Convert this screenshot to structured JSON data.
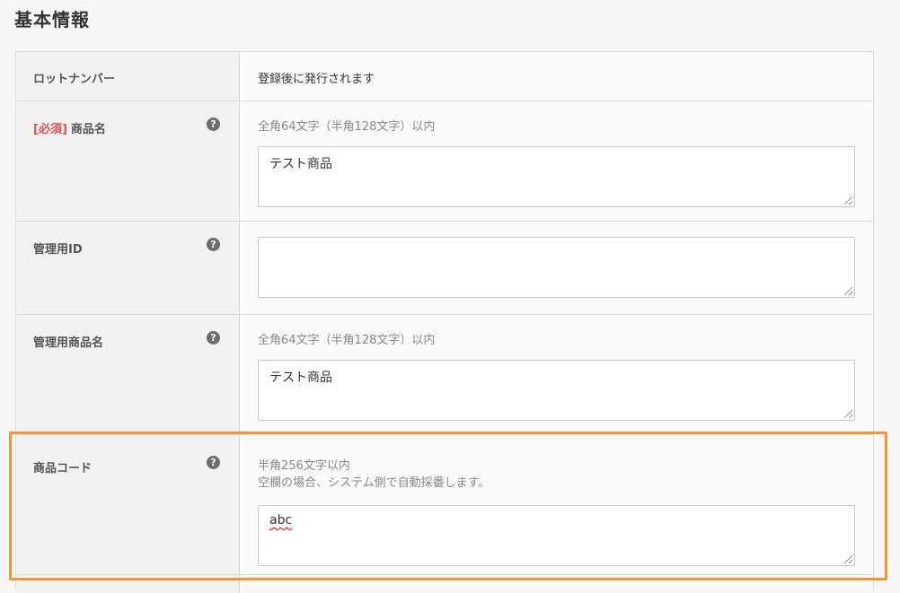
{
  "section_title": "基本情報",
  "rows": [
    {
      "label": "ロットナンバー",
      "value_text": "登録後に発行されます"
    },
    {
      "required_tag": "[必須]",
      "label": "商品名",
      "help_icon": "?",
      "hint": "全角64文字（半角128文字）以内",
      "textarea_value": "テスト商品"
    },
    {
      "label": "管理用ID",
      "help_icon": "?",
      "textarea_value": ""
    },
    {
      "label": "管理用商品名",
      "help_icon": "?",
      "hint": "全角64文字（半角128文字）以内",
      "textarea_value": "テスト商品"
    },
    {
      "label": "商品コード",
      "help_icon": "?",
      "hint_lines": [
        "半角256文字以内",
        "空欄の場合、システム側で自動採番します。"
      ],
      "textarea_value": "abc"
    }
  ],
  "colors": {
    "highlight": "#f7962e",
    "required": "#d9534f"
  },
  "icons": {
    "help": "question-circle-icon",
    "resize": "resize-grip-icon"
  }
}
